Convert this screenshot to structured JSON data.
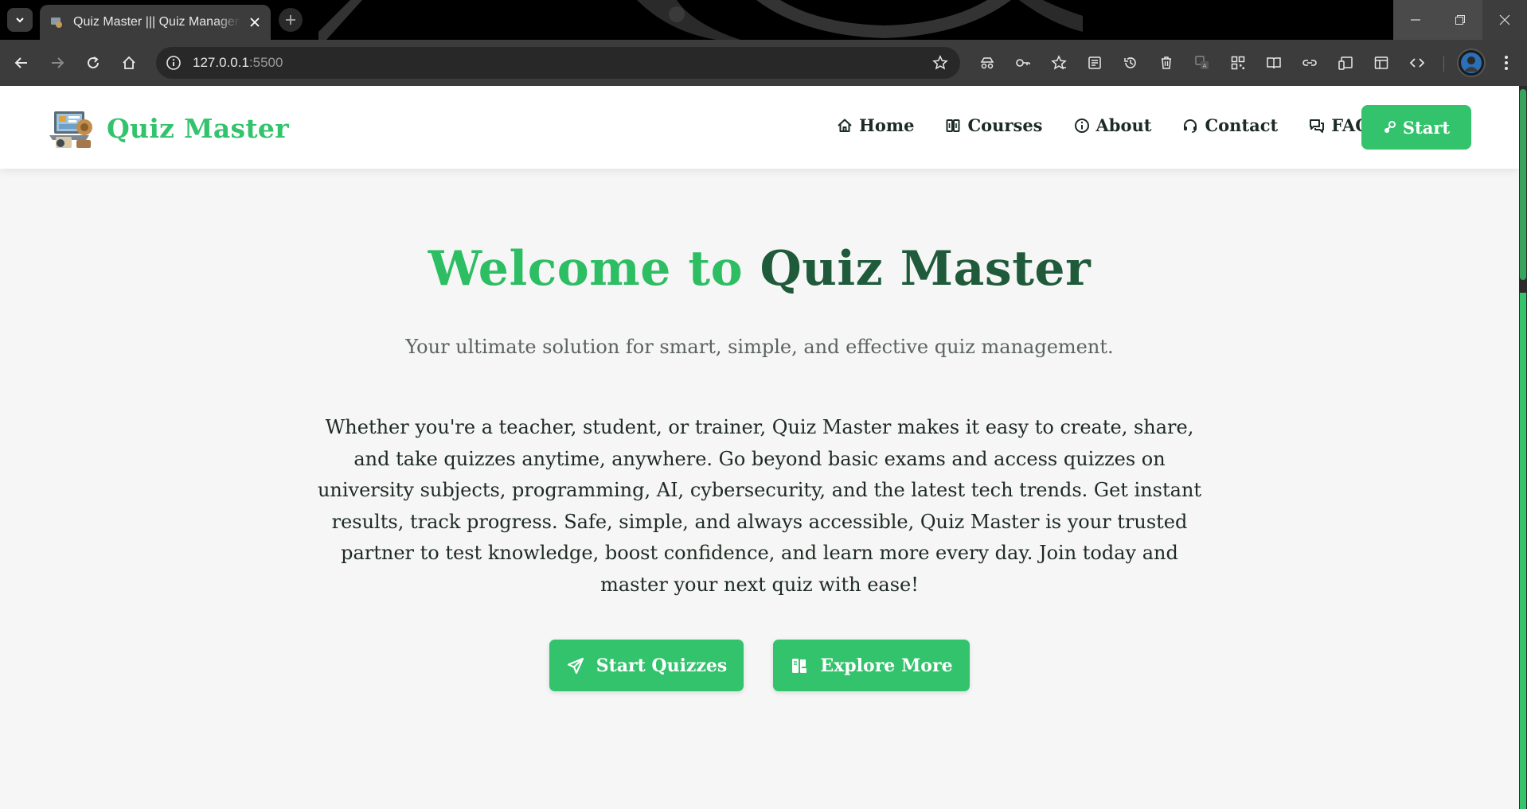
{
  "browser": {
    "tab_title": "Quiz Master ||| Quiz Management",
    "url_host": "127.0.0.1",
    "url_port": ":5500"
  },
  "navbar": {
    "brand": "Quiz Master",
    "links": [
      {
        "label": "Home",
        "icon": "home-icon"
      },
      {
        "label": "Courses",
        "icon": "book-icon"
      },
      {
        "label": "About",
        "icon": "info-icon"
      },
      {
        "label": "Contact",
        "icon": "headset-icon"
      },
      {
        "label": "FAQs",
        "icon": "chat-icon"
      }
    ],
    "start_label": "Start"
  },
  "hero": {
    "title_part1": "Welcome to ",
    "title_part2": "Quiz Master",
    "subtitle": "Your ultimate solution for smart, simple, and effective quiz management.",
    "paragraph": "Whether you're a teacher, student, or trainer, Quiz Master makes it easy to create, share, and take quizzes anytime, anywhere. Go beyond basic exams and access quizzes on university subjects, programming, AI, cybersecurity, and the latest tech trends. Get instant results, track progress. Safe, simple, and always accessible, Quiz Master is your trusted partner to test knowledge, boost confidence, and learn more every day. Join today and master your next quiz with ease!",
    "primary_cta": "Start Quizzes",
    "secondary_cta": "Explore More"
  },
  "colors": {
    "accent": "#32c36c",
    "title_dark": "#1f5a3a",
    "page_bg": "#f5f6f5"
  }
}
